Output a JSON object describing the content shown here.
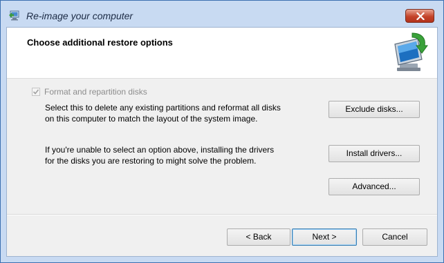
{
  "window": {
    "title": "Re-image your computer",
    "title_icon": "restore-computer-icon",
    "close_icon": "close-icon"
  },
  "header": {
    "title": "Choose additional restore options",
    "icon": "computer-restore-icon"
  },
  "options": {
    "format_checkbox": {
      "label": "Format and repartition disks",
      "checked": true,
      "disabled": true
    },
    "format_description": [
      "Select this to delete any existing partitions and reformat all disks",
      "on this computer to match the layout of the system image."
    ],
    "drivers_description": [
      "If you're unable to select an option above, installing the drivers",
      "for the disks you are restoring to might solve the problem."
    ]
  },
  "buttons": {
    "exclude_disks": "Exclude disks...",
    "install_drivers": "Install drivers...",
    "advanced": "Advanced...",
    "back": "< Back",
    "next": "Next >",
    "cancel": "Cancel"
  },
  "colors": {
    "titlebar": "#c8daf2",
    "close_button": "#c4442a",
    "disabled_text": "#8c8c8c",
    "default_button_border": "#3c7fb1"
  }
}
